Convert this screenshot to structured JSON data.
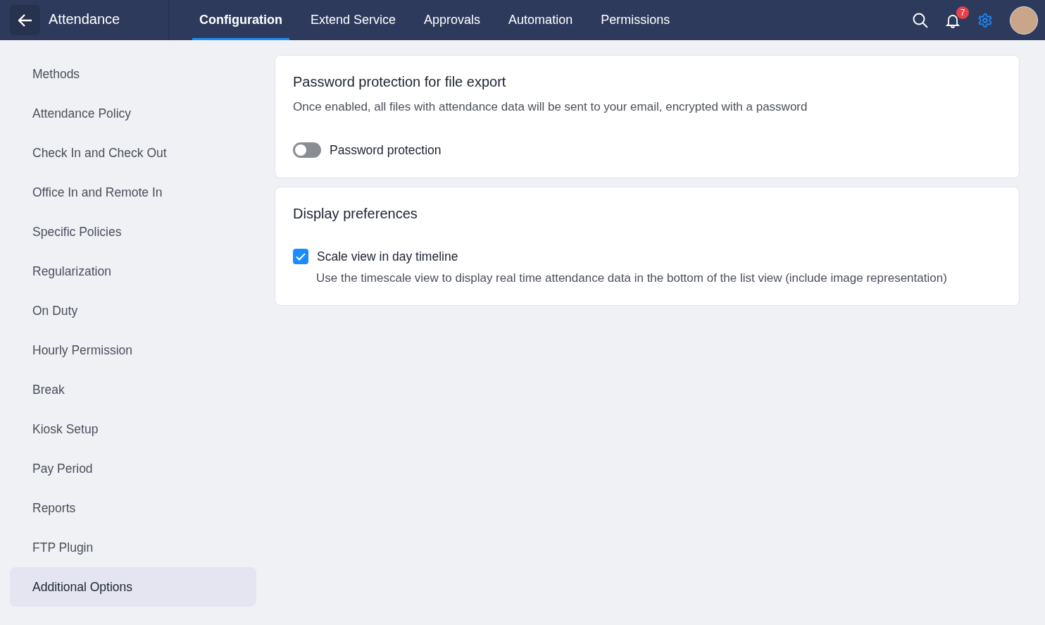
{
  "app_title": "Attendance",
  "tabs": [
    {
      "label": "Configuration",
      "selected": true
    },
    {
      "label": "Extend Service",
      "selected": false
    },
    {
      "label": "Approvals",
      "selected": false
    },
    {
      "label": "Automation",
      "selected": false
    },
    {
      "label": "Permissions",
      "selected": false
    }
  ],
  "notifications": {
    "count": "7"
  },
  "sidebar": {
    "items": [
      {
        "label": "Methods",
        "selected": false
      },
      {
        "label": "Attendance Policy",
        "selected": false
      },
      {
        "label": "Check In and Check Out",
        "selected": false
      },
      {
        "label": "Office In and Remote In",
        "selected": false
      },
      {
        "label": "Specific Policies",
        "selected": false
      },
      {
        "label": "Regularization",
        "selected": false
      },
      {
        "label": "On Duty",
        "selected": false
      },
      {
        "label": "Hourly Permission",
        "selected": false
      },
      {
        "label": "Break",
        "selected": false
      },
      {
        "label": "Kiosk Setup",
        "selected": false
      },
      {
        "label": "Pay Period",
        "selected": false
      },
      {
        "label": "Reports",
        "selected": false
      },
      {
        "label": "FTP Plugin",
        "selected": false
      },
      {
        "label": "Additional Options",
        "selected": true
      }
    ]
  },
  "cards": [
    {
      "title": "Password protection for file export",
      "description": "Once enabled, all files with attendance data will be sent to your email, encrypted with a password",
      "setting": {
        "kind": "toggle",
        "label": "Password protection",
        "on": false
      }
    },
    {
      "title": "Display preferences",
      "setting": {
        "kind": "checkbox",
        "label": "Scale view in day timeline",
        "checked": true,
        "help": "Use the timescale view to display real time attendance data in the bottom of the list view (include image representation)"
      }
    }
  ]
}
